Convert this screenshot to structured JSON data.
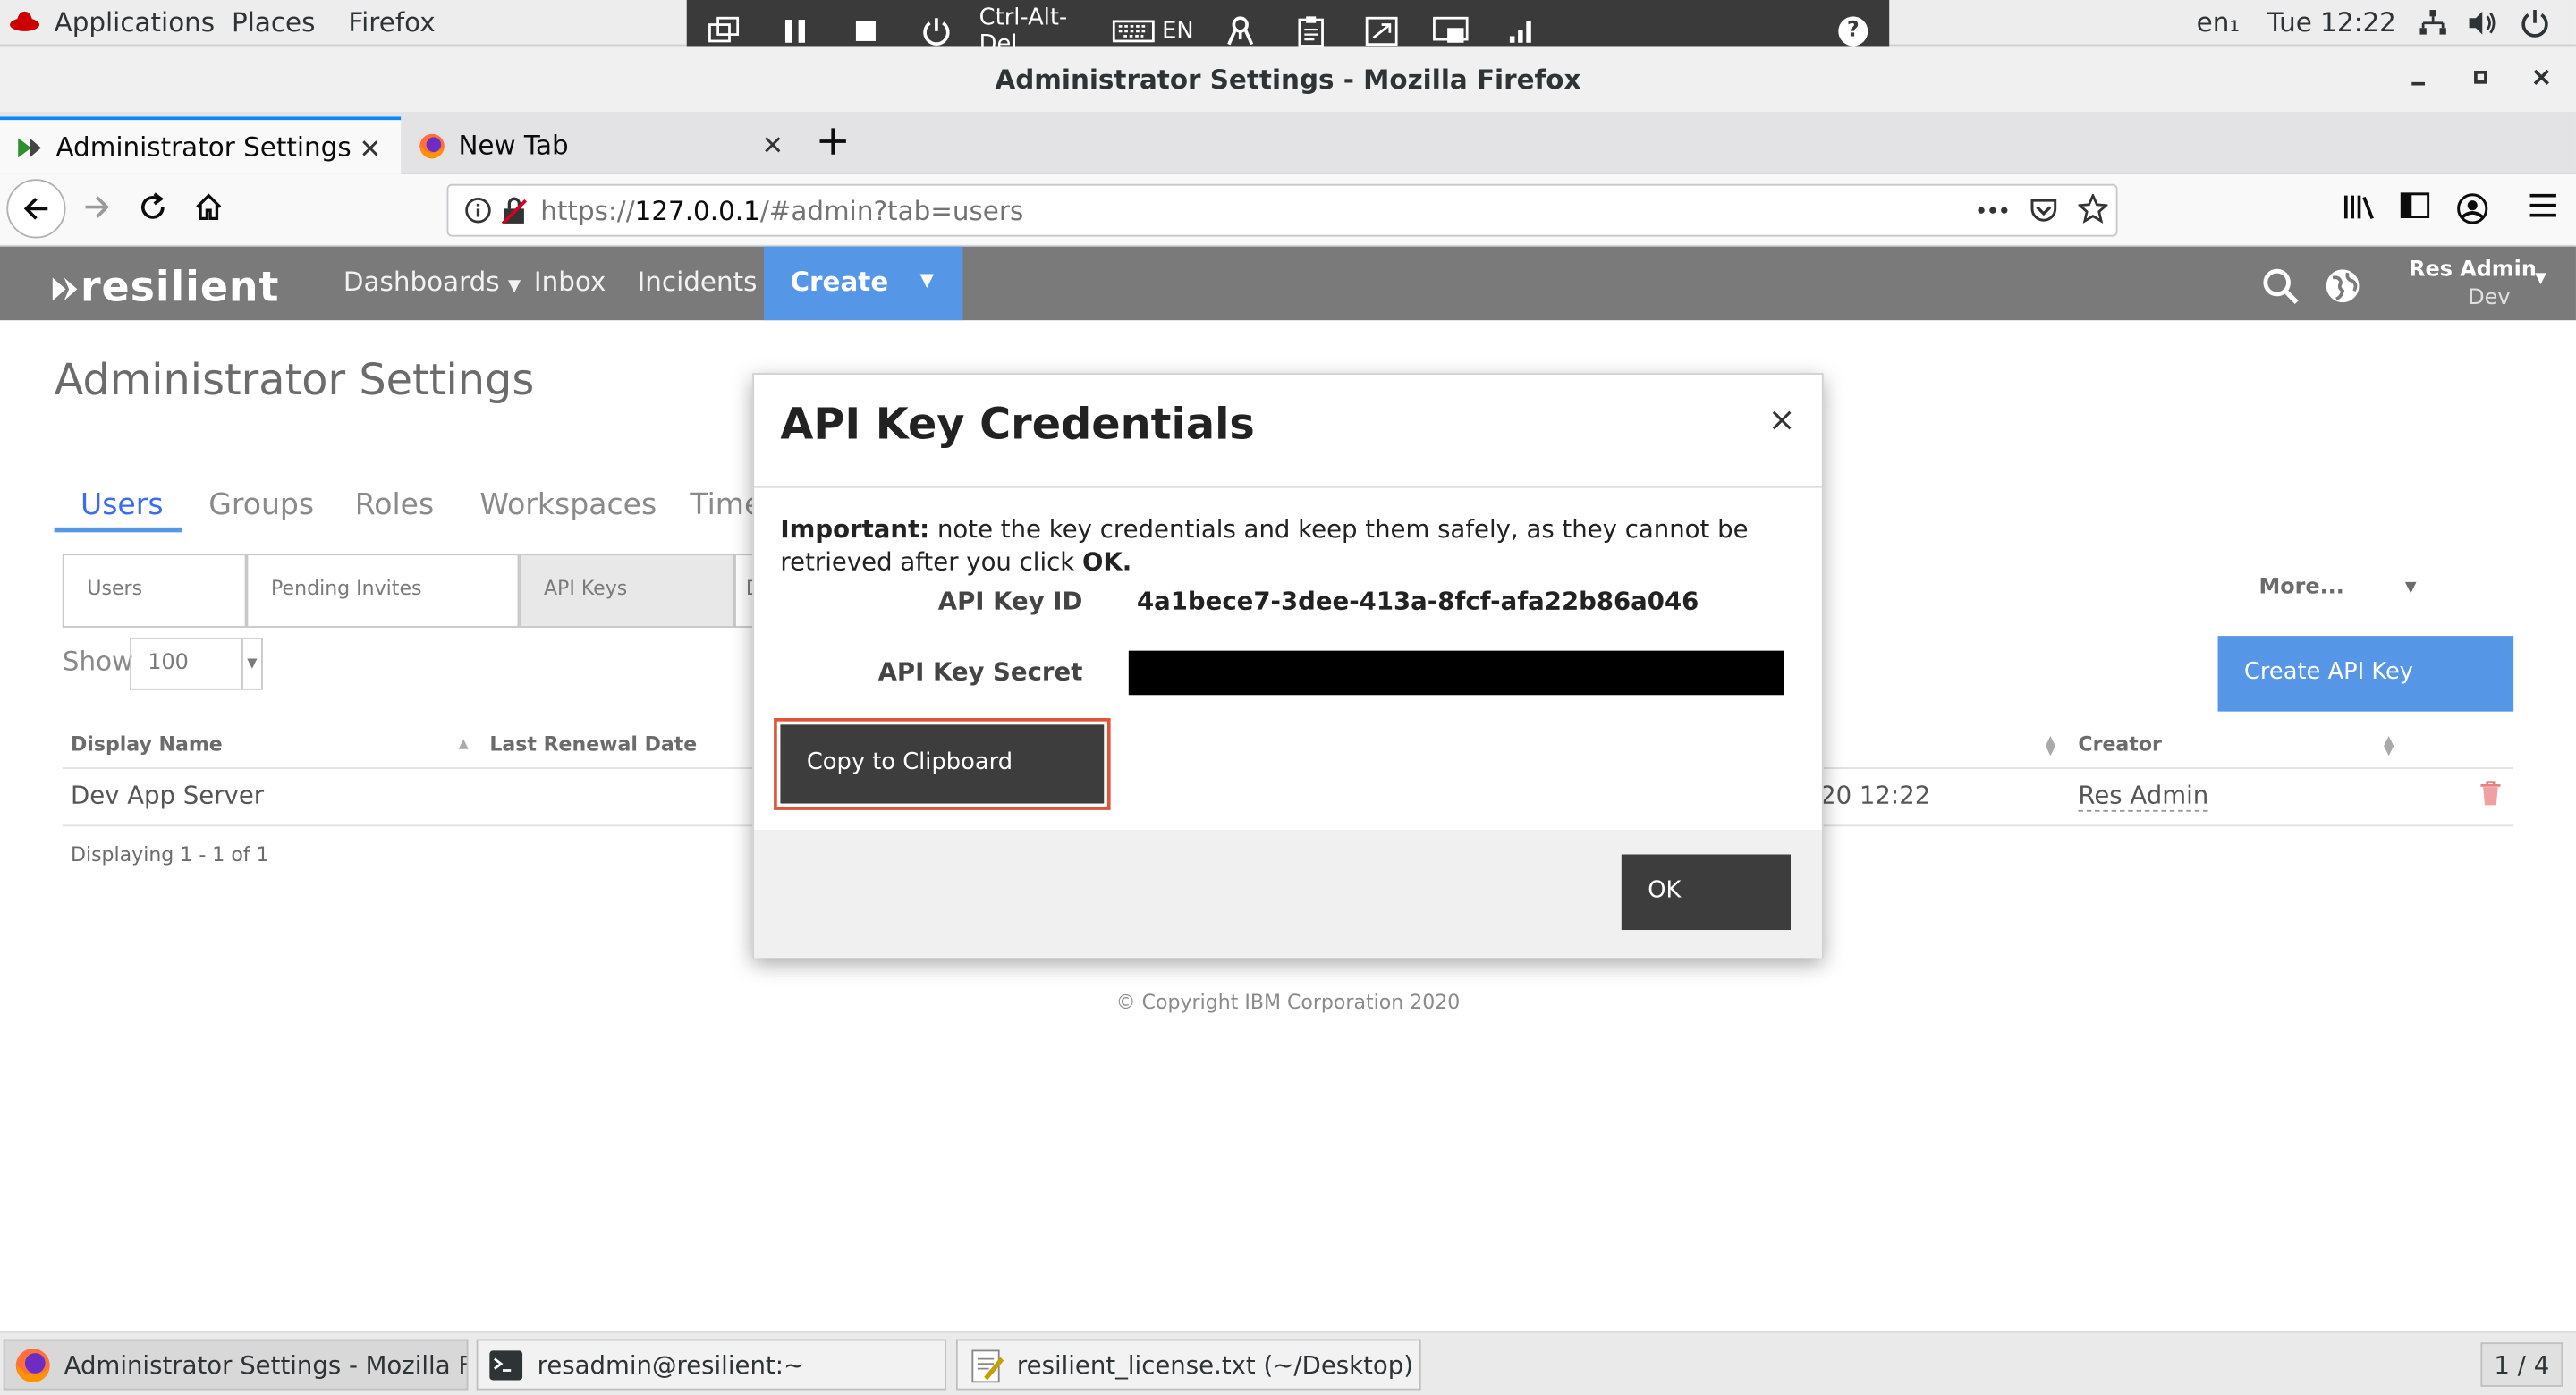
{
  "gnome": {
    "applications": "Applications",
    "places": "Places",
    "firefox": "Firefox",
    "input_method": "en₁",
    "clock": "Tue 12:22"
  },
  "remote_toolbar": {
    "cad": "Ctrl-Alt-Del",
    "lang": "EN",
    "help": "?"
  },
  "window": {
    "title": "Administrator Settings - Mozilla Firefox"
  },
  "tabs": [
    {
      "label": "Administrator Settings"
    },
    {
      "label": "New Tab"
    }
  ],
  "url": {
    "scheme": "https://",
    "host": "127.0.0.1",
    "path": "/#admin?tab=users"
  },
  "app": {
    "logo": "resilient",
    "nav": {
      "dashboards": "Dashboards",
      "inbox": "Inbox",
      "incidents": "Incidents",
      "create": "Create"
    },
    "user": {
      "name": "Res Admin",
      "org": "Dev"
    }
  },
  "page": {
    "title": "Administrator Settings",
    "tabs": [
      "Users",
      "Groups",
      "Roles",
      "Workspaces",
      "Time"
    ],
    "segments": [
      "Users",
      "Pending Invites",
      "API Keys",
      "D"
    ],
    "more": "More...",
    "show_label": "Show",
    "show_value": "100",
    "create_api_key": "Create API Key",
    "table": {
      "headers": {
        "display_name": "Display Name",
        "last_renewal": "Last Renewal Date",
        "creator": "Creator"
      },
      "row": {
        "display_name": "Dev App Server",
        "date_fragment": "20 12:22",
        "creator": "Res Admin"
      }
    },
    "displaying": "Displaying 1 - 1 of 1",
    "copyright": "© Copyright IBM Corporation 2020"
  },
  "modal": {
    "title": "API Key Credentials",
    "close": "×",
    "msg_bold": "Important:",
    "msg_text": " note the key credentials and keep them safely, as they cannot be retrieved after you click ",
    "msg_ok": "OK.",
    "key_id_label": "API Key ID",
    "key_id_value": "4a1bece7-3dee-413a-8fcf-afa22b86a046",
    "secret_label": "API Key Secret",
    "copy_button": "Copy to Clipboard",
    "ok_button": "OK"
  },
  "taskbar": {
    "items": [
      {
        "label": "Administrator Settings - Mozilla Fire..."
      },
      {
        "label": "resadmin@resilient:~"
      },
      {
        "label": "resilient_license.txt (~/Desktop) - g..."
      }
    ],
    "pager": "1 / 4"
  }
}
